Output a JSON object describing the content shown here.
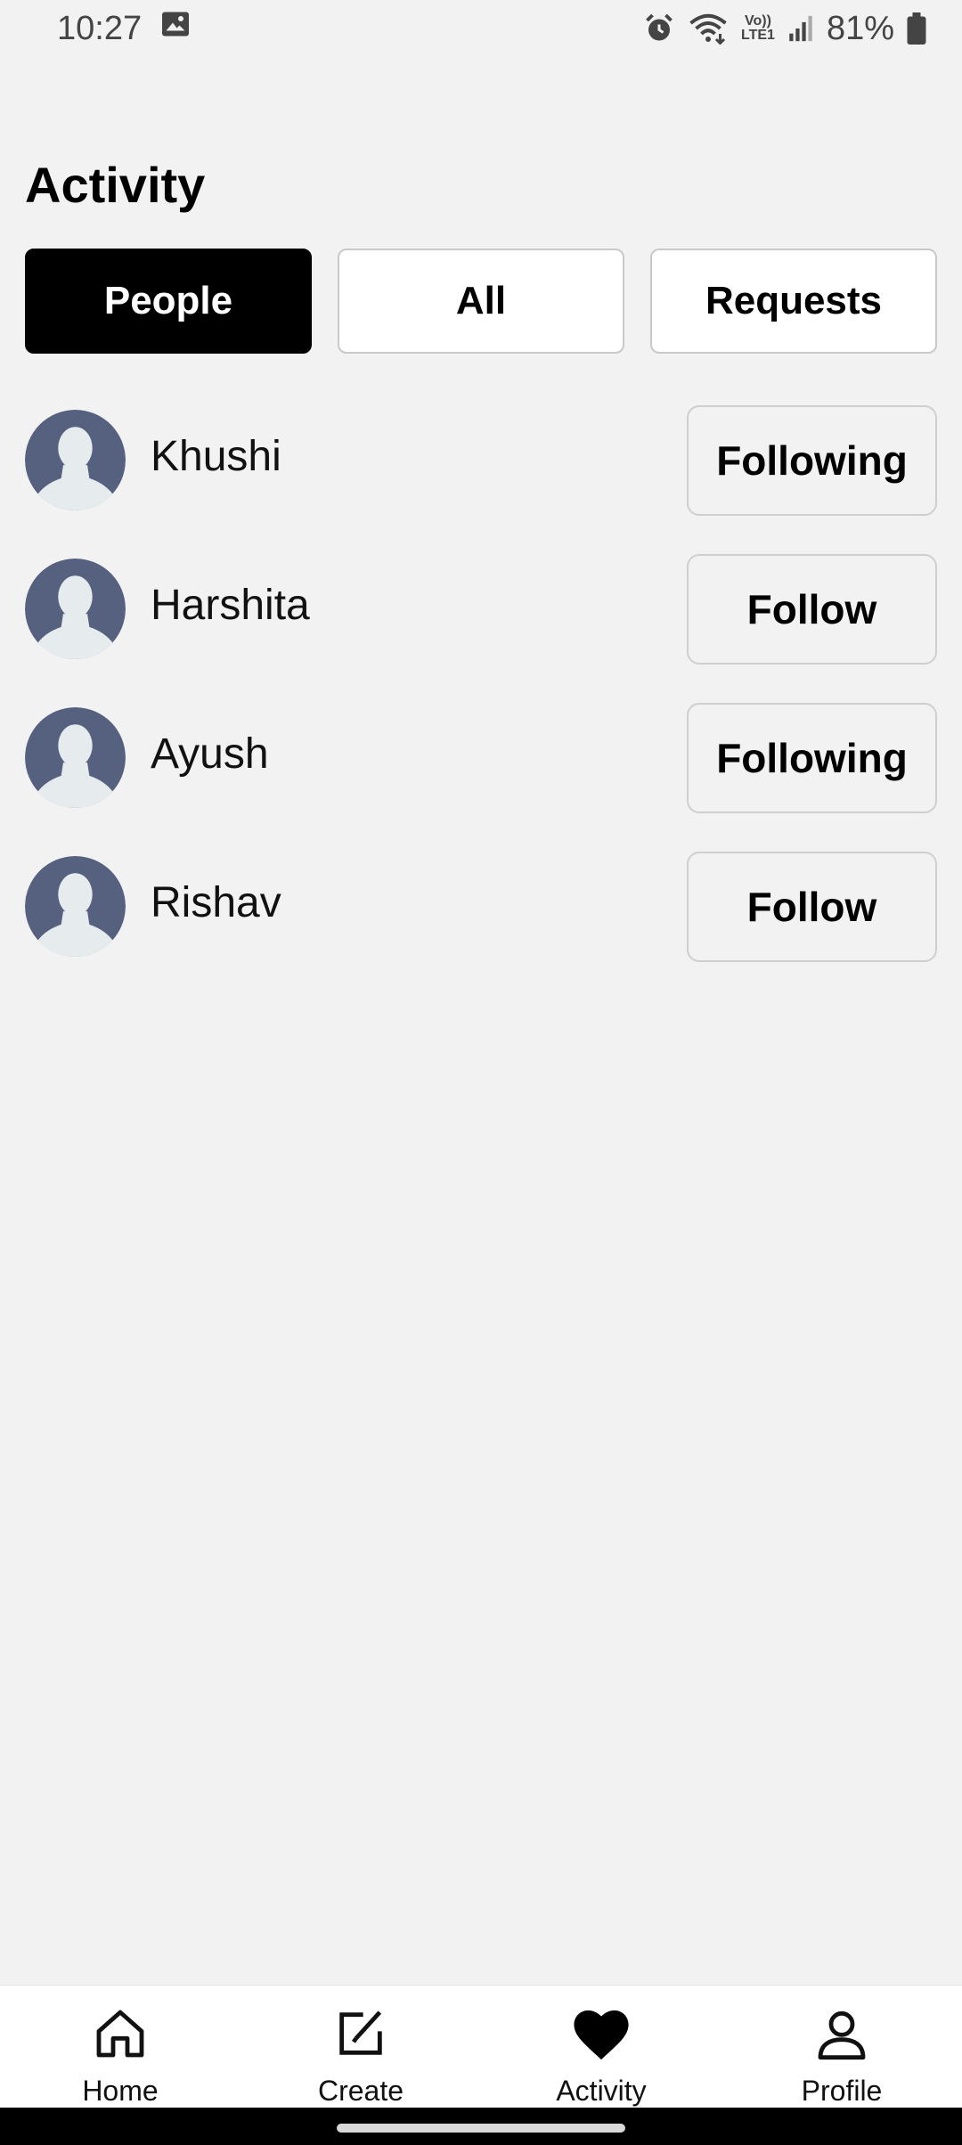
{
  "status_bar": {
    "time": "10:27",
    "battery": "81%",
    "network_badge_top": "Vo))",
    "network_badge_bottom": "LTE1",
    "icons": [
      "gallery-icon",
      "alarm-icon",
      "wifi-icon",
      "signal-icon",
      "battery-icon"
    ]
  },
  "header": {
    "title": "Activity"
  },
  "tabs": [
    {
      "label": "People",
      "active": true
    },
    {
      "label": "All",
      "active": false
    },
    {
      "label": "Requests",
      "active": false
    }
  ],
  "people": [
    {
      "name": "Khushi",
      "button": "Following"
    },
    {
      "name": "Harshita",
      "button": "Follow"
    },
    {
      "name": "Ayush",
      "button": "Following"
    },
    {
      "name": "Rishav",
      "button": "Follow"
    }
  ],
  "bottom_nav": [
    {
      "label": "Home",
      "icon": "home-icon"
    },
    {
      "label": "Create",
      "icon": "create-icon"
    },
    {
      "label": "Activity",
      "icon": "heart-icon",
      "active": true
    },
    {
      "label": "Profile",
      "icon": "profile-icon"
    }
  ],
  "colors": {
    "background": "#f2f2f2",
    "tab_active": "#000000",
    "avatar_bg": "#56617f",
    "avatar_figure": "#e6ebee"
  }
}
